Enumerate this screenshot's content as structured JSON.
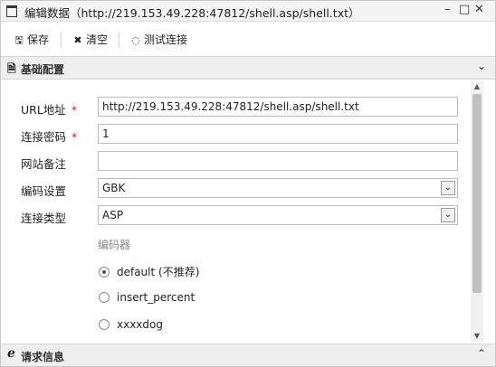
{
  "window": {
    "title": "编辑数据（http://219.153.49.228:47812/shell.asp/shell.txt）",
    "minimize": "–",
    "restore": "□",
    "close": "✕"
  },
  "toolbar": {
    "save_label": "保存",
    "clear_label": "清空",
    "test_label": "测试连接"
  },
  "sections": {
    "basic": {
      "label": "基础配置",
      "icon": "document-icon"
    },
    "request": {
      "label": "请求信息",
      "icon": "e-icon"
    }
  },
  "form": {
    "url": {
      "label": "URL地址",
      "value": "http://219.153.49.228:47812/shell.asp/shell.txt",
      "required": "*"
    },
    "password": {
      "label": "连接密码",
      "value": "1",
      "required": "*"
    },
    "note": {
      "label": "网站备注",
      "value": ""
    },
    "encoding": {
      "label": "编码设置",
      "value": "GBK"
    },
    "type": {
      "label": "连接类型",
      "value": "ASP"
    },
    "encoder": {
      "title": "编码器",
      "options": [
        "default (不推荐)",
        "insert_percent",
        "xxxxdog"
      ],
      "selected": "default (不推荐)"
    }
  }
}
